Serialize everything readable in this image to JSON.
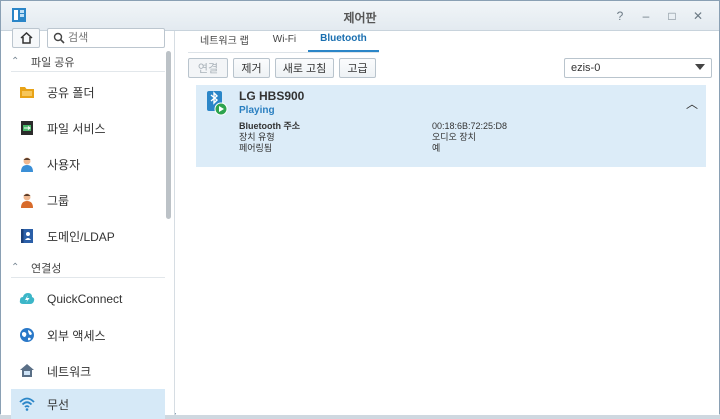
{
  "window": {
    "title": "제어판"
  },
  "controls": {
    "help": "?",
    "minimize": "–",
    "maximize": "□",
    "close": "✕"
  },
  "search": {
    "placeholder": "검색"
  },
  "sidebar": {
    "sections": [
      {
        "label": "파일 공유",
        "icon": "chevron-up-icon"
      },
      {
        "label": "연결성",
        "icon": "chevron-up-icon"
      }
    ],
    "items": [
      {
        "label": "공유 폴더",
        "icon": "folder-share-icon",
        "color": "#e8a317"
      },
      {
        "label": "파일 서비스",
        "icon": "file-services-icon",
        "color": "#2e9e4f"
      },
      {
        "label": "사용자",
        "icon": "user-icon",
        "color": "#3b8fd6"
      },
      {
        "label": "그룹",
        "icon": "group-icon",
        "color": "#d86b2b"
      },
      {
        "label": "도메인/LDAP",
        "icon": "domain-ldap-icon",
        "color": "#2b5fa8"
      },
      {
        "label": "QuickConnect",
        "icon": "quickconnect-icon",
        "color": "#3cb6c8"
      },
      {
        "label": "외부 액세스",
        "icon": "globe-icon",
        "color": "#2a78c8"
      },
      {
        "label": "네트워크",
        "icon": "network-icon",
        "color": "#5a6f86"
      },
      {
        "label": "무선",
        "icon": "wireless-icon",
        "color": "#2b86c8"
      }
    ]
  },
  "tabs": [
    {
      "label": "네트워크 랩"
    },
    {
      "label": "Wi-Fi"
    },
    {
      "label": "Bluetooth"
    }
  ],
  "active_tab": "Bluetooth",
  "toolbar": {
    "connect": "연결",
    "remove": "제거",
    "refresh": "새로 고침",
    "advanced": "고급",
    "adapter": "ezis-0"
  },
  "device": {
    "name": "LG HBS900",
    "status": "Playing",
    "icon": "bluetooth-headset-icon",
    "properties": [
      {
        "key": "Bluetooth 주소",
        "value": "00:18:6B:72:25:D8"
      },
      {
        "key": "장치 유형",
        "value": "오디오 장치"
      },
      {
        "key": "페어링됨",
        "value": "예"
      }
    ]
  },
  "colors": {
    "accent": "#2b86c8",
    "selected_row": "#dcecf8",
    "active_nav": "#d6e9f7"
  }
}
